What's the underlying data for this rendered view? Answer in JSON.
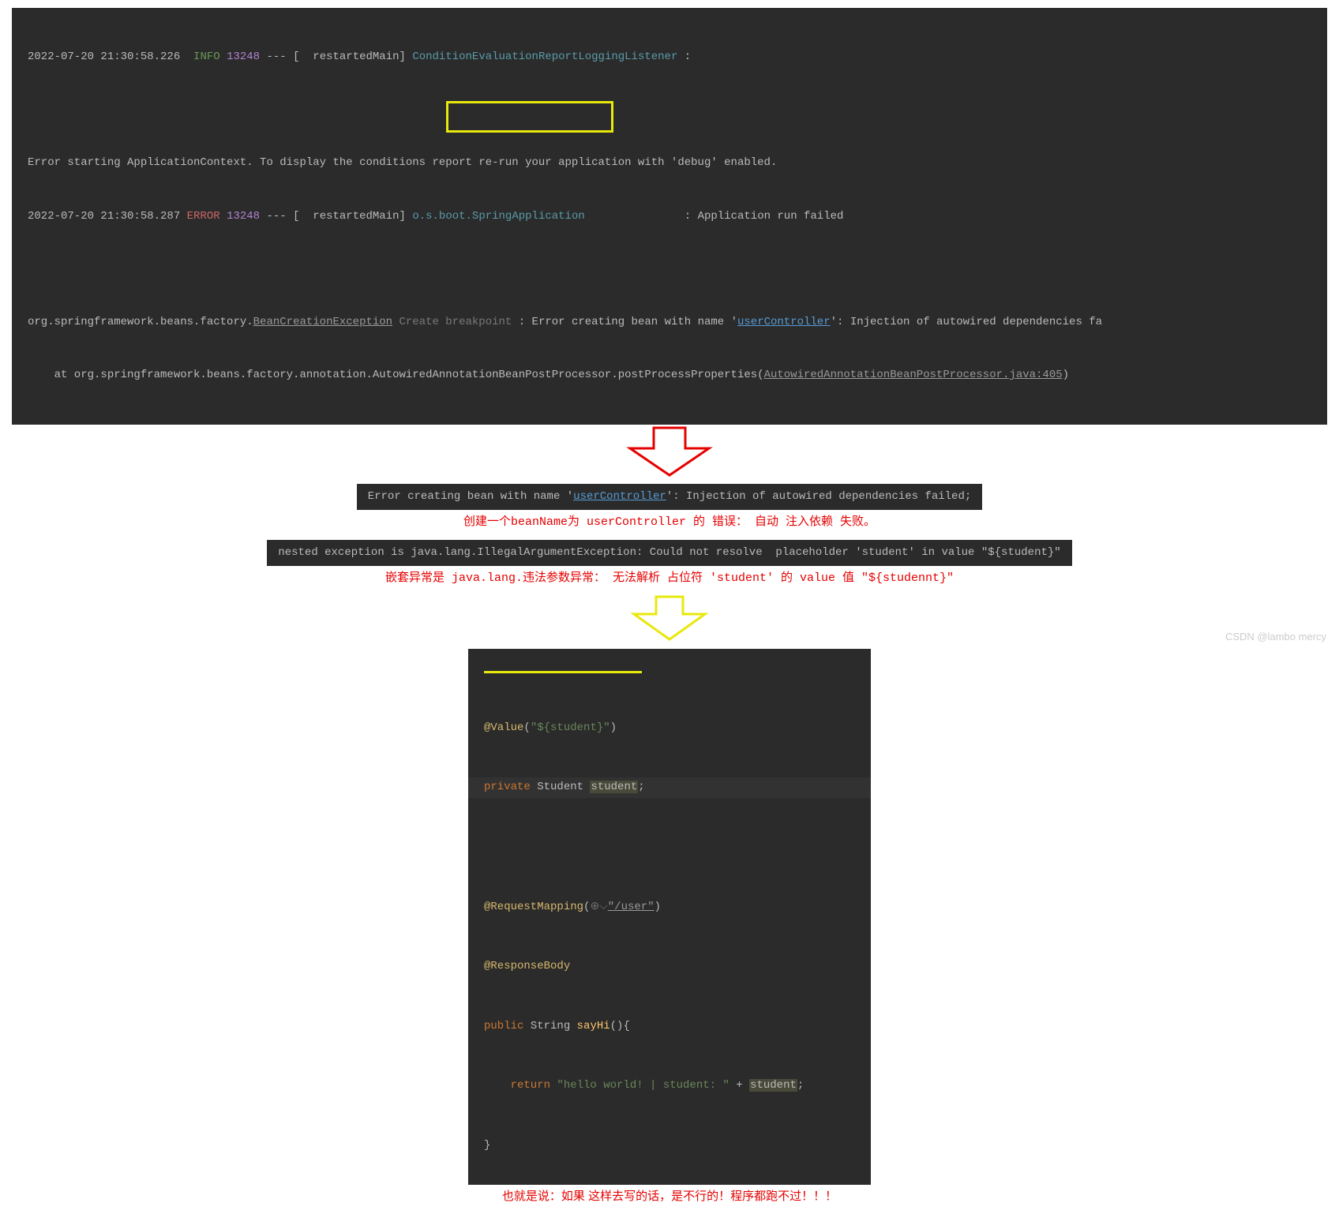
{
  "log": {
    "line1": {
      "ts": "2022-07-20 21:30:58.226",
      "level": "INFO",
      "pid": "13248",
      "dashes": " --- [  restartedMain] ",
      "logger": "ConditionEvaluationReportLoggingListener",
      "tail": " : "
    },
    "line2": "Error starting ApplicationContext. To display the conditions report re-run your application with 'debug' enabled.",
    "line3": {
      "ts": "2022-07-20 21:30:58.287",
      "level": "ERROR",
      "pid": "13248",
      "dashes": " --- [  restartedMain] ",
      "logger": "o.s.boot.SpringApplication              ",
      "tail": " : Application run failed"
    },
    "line4": {
      "prefix": "org.springframework.beans.factory.",
      "exception": "BeanCreationException",
      "create_bp": " Create breakpoint ",
      "mid": ": Error creating bean with name '",
      "bean": "userController",
      "suffix": "': Injection of autowired dependencies fa"
    },
    "line5": {
      "prefix": "    at org.springframework.beans.factory.annotation.AutowiredAnnotationBeanPostProcessor.postProcessProperties(",
      "link": "AutowiredAnnotationBeanPostProcessor.java:405",
      "suffix": ")"
    }
  },
  "snippet1": {
    "pre": "Error creating bean with name '",
    "bean": "userController",
    "post": "': Injection of autowired dependencies failed;"
  },
  "annotation1": "创建一个beanName为 userController 的 错误：  自动 注入依赖 失败。",
  "snippet2": "nested exception is java.lang.IllegalArgumentException: Could not resolve  placeholder 'student' in value \"${student}\"",
  "annotation2": "嵌套异常是 java.lang.违法参数异常：  无法解析 占位符 'student' 的 value 值 \"${studennt}\"",
  "code": {
    "l1": {
      "anno": "@Value",
      "paren_open": "(",
      "str": "\"${student}\"",
      "paren_close": ")"
    },
    "l2": {
      "mod": "private",
      "type": " Student ",
      "var": "student",
      "semi": ";"
    },
    "l3": "",
    "l4": {
      "anno": "@RequestMapping",
      "paren_open": "(",
      "icon": "⊕⌵",
      "str": "\"/user\"",
      "paren_close": ")"
    },
    "l5": {
      "anno": "@ResponseBody"
    },
    "l6": {
      "mod": "public",
      "type": " String ",
      "method": "sayHi",
      "paren": "(){"
    },
    "l7": {
      "mod": "    return ",
      "str": "\"hello world! | student: \"",
      "plus": " + ",
      "var": "student",
      "semi": ";"
    },
    "l8": "}"
  },
  "annotation3": "也就是说：如果 这样去写的话，是不行的！程序都跑不过！！！",
  "watermark": "CSDN @lambo mercy"
}
